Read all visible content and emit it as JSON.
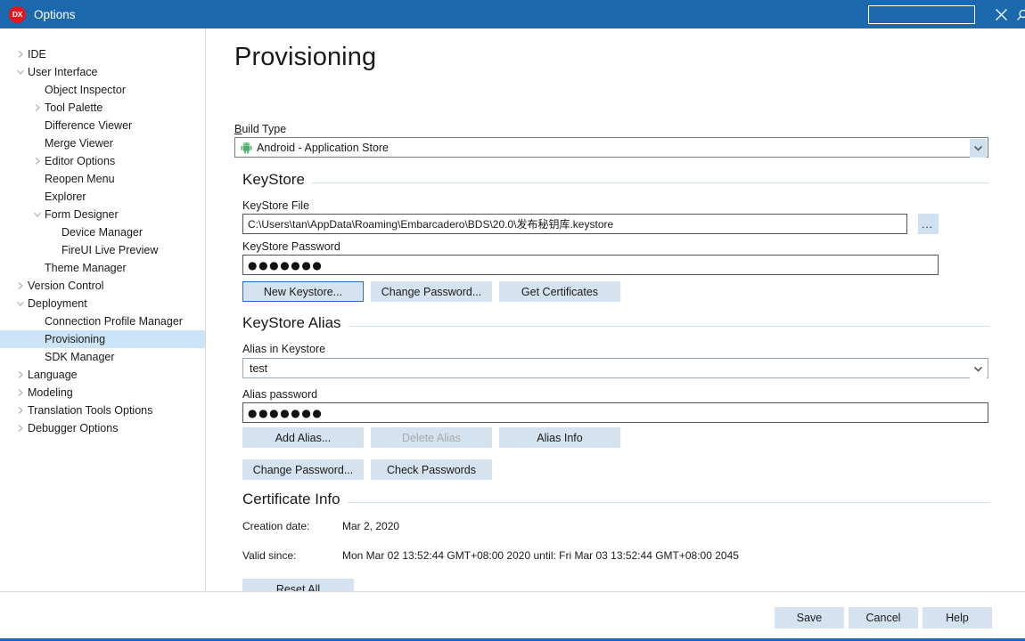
{
  "window": {
    "logo_text": "DX",
    "title": "Options",
    "search_placeholder": "",
    "search_value": "",
    "close_label": "✕"
  },
  "sidebar": {
    "items": [
      {
        "label": "IDE",
        "indent": 0,
        "arrow": "collapsed",
        "selected": false
      },
      {
        "label": "User Interface",
        "indent": 0,
        "arrow": "expanded",
        "selected": false
      },
      {
        "label": "Object Inspector",
        "indent": 1,
        "arrow": "none",
        "selected": false
      },
      {
        "label": "Tool Palette",
        "indent": 1,
        "arrow": "collapsed",
        "selected": false
      },
      {
        "label": "Difference Viewer",
        "indent": 1,
        "arrow": "none",
        "selected": false
      },
      {
        "label": "Merge Viewer",
        "indent": 1,
        "arrow": "none",
        "selected": false
      },
      {
        "label": "Editor Options",
        "indent": 1,
        "arrow": "collapsed",
        "selected": false
      },
      {
        "label": "Reopen Menu",
        "indent": 1,
        "arrow": "none",
        "selected": false
      },
      {
        "label": "Explorer",
        "indent": 1,
        "arrow": "none",
        "selected": false
      },
      {
        "label": "Form Designer",
        "indent": 1,
        "arrow": "expanded",
        "selected": false
      },
      {
        "label": "Device Manager",
        "indent": 2,
        "arrow": "none",
        "selected": false
      },
      {
        "label": "FireUI Live Preview",
        "indent": 2,
        "arrow": "none",
        "selected": false
      },
      {
        "label": "Theme Manager",
        "indent": 1,
        "arrow": "none",
        "selected": false
      },
      {
        "label": "Version Control",
        "indent": 0,
        "arrow": "collapsed",
        "selected": false
      },
      {
        "label": "Deployment",
        "indent": 0,
        "arrow": "expanded",
        "selected": false
      },
      {
        "label": "Connection Profile Manager",
        "indent": 1,
        "arrow": "none",
        "selected": false
      },
      {
        "label": "Provisioning",
        "indent": 1,
        "arrow": "none",
        "selected": true
      },
      {
        "label": "SDK Manager",
        "indent": 1,
        "arrow": "none",
        "selected": false
      },
      {
        "label": "Language",
        "indent": 0,
        "arrow": "collapsed",
        "selected": false
      },
      {
        "label": "Modeling",
        "indent": 0,
        "arrow": "collapsed",
        "selected": false
      },
      {
        "label": "Translation Tools Options",
        "indent": 0,
        "arrow": "collapsed",
        "selected": false
      },
      {
        "label": "Debugger Options",
        "indent": 0,
        "arrow": "collapsed",
        "selected": false
      }
    ]
  },
  "main": {
    "page_title": "Provisioning",
    "build_type": {
      "label_accel": "B",
      "label_rest": "uild Type",
      "value": "Android - Application Store",
      "icon": "android-icon"
    },
    "keystore": {
      "section_title": "KeyStore",
      "file_label": "KeyStore File",
      "file_value": "C:\\Users\\tan\\AppData\\Roaming\\Embarcadero\\BDS\\20.0\\发布秘钥库.keystore",
      "browse_label": "...",
      "password_label": "KeyStore Password",
      "password_value": "●●●●●●●",
      "buttons": [
        {
          "label": "New Keystore...",
          "focused": true,
          "disabled": false
        },
        {
          "label": "Change Password...",
          "focused": false,
          "disabled": false
        },
        {
          "label": "Get Certificates",
          "focused": false,
          "disabled": false
        }
      ]
    },
    "alias": {
      "section_title": "KeyStore Alias",
      "alias_label": "Alias in Keystore",
      "alias_value": "test",
      "password_label": "Alias password",
      "password_value": "●●●●●●●",
      "buttons_row1": [
        {
          "label": "Add Alias...",
          "focused": false,
          "disabled": false
        },
        {
          "label": "Delete Alias",
          "focused": false,
          "disabled": true
        },
        {
          "label": "Alias Info",
          "focused": false,
          "disabled": false
        }
      ],
      "buttons_row2": [
        {
          "label": "Change Password...",
          "focused": false,
          "disabled": false
        },
        {
          "label": "Check Passwords",
          "focused": false,
          "disabled": false
        }
      ]
    },
    "certificate": {
      "section_title": "Certificate Info",
      "creation_label": "Creation date:",
      "creation_value": "Mar 2, 2020",
      "valid_label": "Valid since:",
      "valid_value": "Mon Mar 02 13:52:44 GMT+08:00 2020 until: Fri Mar 03 13:52:44 GMT+08:00 2045",
      "reset_label": "Reset All"
    }
  },
  "footer": {
    "save_label": "Save",
    "cancel_label": "Cancel",
    "help_label": "Help"
  },
  "colors": {
    "titlebar": "#1b68ad",
    "logo": "#e8141c",
    "selection": "#cce4f7",
    "button": "#d5e2f0",
    "focus_border": "#2a6fb5",
    "android_green": "#4cae6a"
  }
}
